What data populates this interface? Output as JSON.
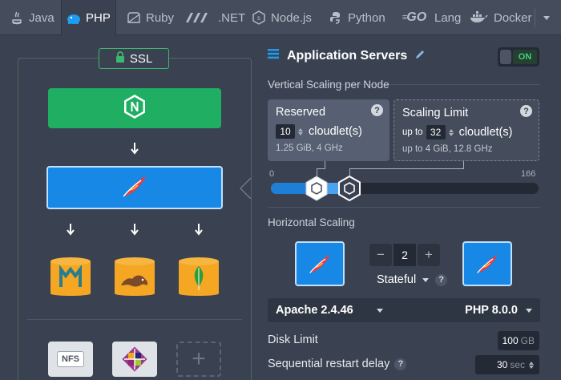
{
  "tabs": [
    {
      "label": "Java",
      "icon": "java-icon",
      "active": false
    },
    {
      "label": "PHP",
      "icon": "php-icon",
      "active": true
    },
    {
      "label": "Ruby",
      "icon": "ruby-icon",
      "active": false
    },
    {
      "label": ".NET",
      "icon": "dotnet-icon",
      "active": false
    },
    {
      "label": "Node.js",
      "icon": "nodejs-icon",
      "active": false
    },
    {
      "label": "Python",
      "icon": "python-icon",
      "active": false
    },
    {
      "label": "Lang",
      "logo_text": "GO",
      "icon": "go-icon",
      "active": false
    },
    {
      "label": "Docker",
      "icon": "docker-icon",
      "active": false
    }
  ],
  "topology": {
    "ssl_label": "SSL",
    "load_balancer": "nginx-icon",
    "app_server": "apache-feather-icon",
    "databases": [
      "mariadb-icon",
      "postgresql-icon",
      "mongodb-icon"
    ],
    "storage": {
      "nfs_label": "NFS"
    }
  },
  "panel": {
    "title": "Application Servers",
    "toggle_label": "ON",
    "vertical_label": "Vertical Scaling per Node",
    "reserved": {
      "title": "Reserved",
      "value": "10",
      "unit": "cloudlet(s)",
      "sub": "1.25 GiB, 4 GHz"
    },
    "limit": {
      "title": "Scaling Limit",
      "prefix": "up to",
      "value": "32",
      "unit": "cloudlet(s)",
      "sub": "up to 4 GiB, 12.8 GHz"
    },
    "scale_min": "0",
    "scale_max": "166",
    "horizontal_label": "Horizontal Scaling",
    "node_count": "2",
    "stepper_minus": "−",
    "stepper_plus": "+",
    "stateful_label": "Stateful",
    "help": "?",
    "server_version": "Apache 2.4.46",
    "engine_version": "PHP 8.0.0",
    "disk_label": "Disk Limit",
    "disk_value": "100",
    "disk_unit": "GB",
    "restart_label": "Sequential restart delay",
    "restart_value": "30",
    "restart_unit": "sec"
  },
  "colors": {
    "accent": "#1788e6",
    "balancer": "#1fae62",
    "on": "#3fd07f",
    "db": "#f5a623"
  }
}
